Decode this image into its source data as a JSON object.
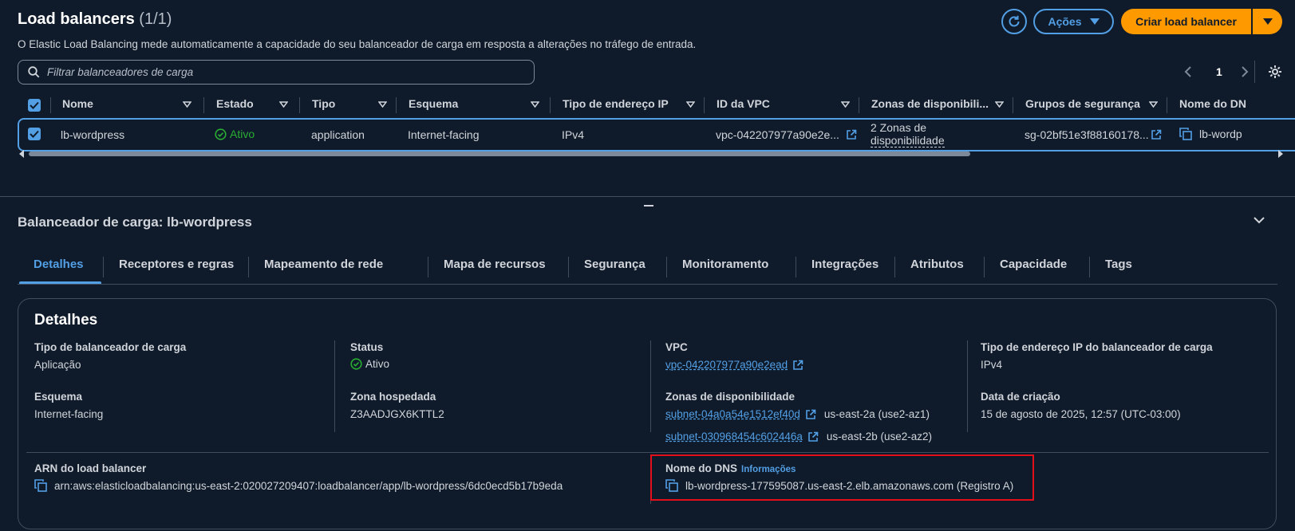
{
  "header": {
    "title": "Load balancers",
    "count": "(1/1)",
    "subtitle": "O Elastic Load Balancing mede automaticamente a capacidade do seu balanceador de carga em resposta a alterações no tráfego de entrada.",
    "actions_label": "Ações",
    "create_label": "Criar load balancer"
  },
  "search": {
    "placeholder": "Filtrar balanceadores de carga"
  },
  "pagination": {
    "page": "1"
  },
  "table": {
    "columns": [
      "Nome",
      "Estado",
      "Tipo",
      "Esquema",
      "Tipo de endereço IP",
      "ID da VPC",
      "Zonas de disponibili...",
      "Grupos de segurança",
      "Nome do DN"
    ],
    "rows": [
      {
        "name": "lb-wordpress",
        "state": "Ativo",
        "type": "application",
        "scheme": "Internet-facing",
        "ip_type": "IPv4",
        "vpc": "vpc-042207977a90e2e...",
        "zones_line1": "2 Zonas de",
        "zones_line2": "disponibilidade",
        "security_group": "sg-02bf51e3f88160178...",
        "dns": "lb-wordp"
      }
    ]
  },
  "panel": {
    "title": "Balanceador de carga: lb-wordpress",
    "tabs": [
      "Detalhes",
      "Receptores e regras",
      "Mapeamento de rede",
      "Mapa de recursos",
      "Segurança",
      "Monitoramento",
      "Integrações",
      "Atributos",
      "Capacidade",
      "Tags"
    ],
    "active_tab": "Detalhes"
  },
  "details": {
    "heading": "Detalhes",
    "type_label": "Tipo de balanceador de carga",
    "type_value": "Aplicação",
    "scheme_label": "Esquema",
    "scheme_value": "Internet-facing",
    "status_label": "Status",
    "status_value": "Ativo",
    "zone_label": "Zona hospedada",
    "zone_value": "Z3AADJGX6KTTL2",
    "vpc_label": "VPC",
    "vpc_value": "vpc-042207977a90e2ead",
    "az_label": "Zonas de disponibilidade",
    "az": [
      {
        "subnet": "subnet-04a0a54e1512ef40d",
        "zone": "us-east-2a (use2-az1)"
      },
      {
        "subnet": "subnet-030968454c602446a",
        "zone": "us-east-2b (use2-az2)"
      }
    ],
    "ip_type_label": "Tipo de endereço IP do balanceador de carga",
    "ip_type_value": "IPv4",
    "created_label": "Data de criação",
    "created_value": "15 de agosto de 2025, 12:57 (UTC-03:00)",
    "arn_label": "ARN do load balancer",
    "arn_value": "arn:aws:elasticloadbalancing:us-east-2:020027209407:loadbalancer/app/lb-wordpress/6dc0ecd5b17b9eda",
    "dns_label": "Nome do DNS",
    "dns_info": "Informações",
    "dns_value": "lb-wordpress-177595087.us-east-2.elb.amazonaws.com (Registro A)"
  },
  "colors": {
    "accent": "#539fe5",
    "primary_button": "#ff9900",
    "success": "#29ad32",
    "highlight_box": "#e3101b",
    "background": "#0f1b2a"
  }
}
